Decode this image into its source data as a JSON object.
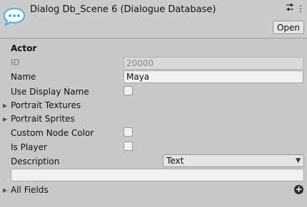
{
  "header": {
    "title": "Dialog Db_Scene 6 (Dialogue Database)",
    "open_label": "Open",
    "icons": [
      "dialogue-database-icon",
      "settings-sliders-icon",
      "more-options-icon"
    ]
  },
  "actor": {
    "section_title": "Actor",
    "id_label": "ID",
    "id_value": "20000",
    "name_label": "Name",
    "name_value": "Maya",
    "use_display_name_label": "Use Display Name",
    "use_display_name_checked": false,
    "portrait_textures_label": "Portrait Textures",
    "portrait_sprites_label": "Portrait Sprites",
    "custom_node_color_label": "Custom Node Color",
    "custom_node_color_checked": false,
    "is_player_label": "Is Player",
    "is_player_checked": false,
    "description_label": "Description",
    "description_type": "Text",
    "description_value": "",
    "all_fields_label": "All Fields"
  },
  "colors": {
    "panel_bg": "#c8c8c8",
    "field_bg": "#f0f0f0",
    "icon_blue": "#4fb3e8"
  }
}
